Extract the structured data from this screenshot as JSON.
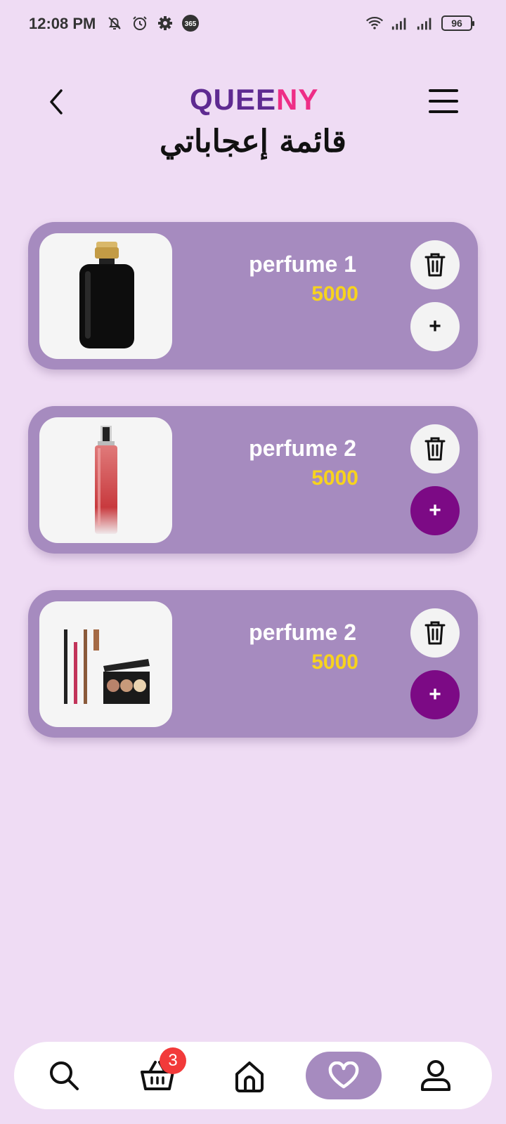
{
  "status_bar": {
    "time": "12:08 PM",
    "left_icons": [
      "mute-bell-icon",
      "alarm-icon",
      "gear-icon",
      "app-365-icon"
    ],
    "app_badge_text": "365",
    "right_icons": [
      "wifi-icon",
      "signal-icon",
      "signal-icon"
    ],
    "battery": "96"
  },
  "header": {
    "logo_part1": "QUEE",
    "logo_part2": "NY",
    "logo_color_1": "#5e2a91",
    "logo_color_2": "#ee2d86",
    "title": "قائمة إعجاباتي"
  },
  "items": [
    {
      "name": "perfume 1",
      "price": "5000",
      "image": "black-perfume-bottle",
      "add_active": false
    },
    {
      "name": "perfume 2",
      "price": "5000",
      "image": "red-perfume-spray",
      "add_active": true
    },
    {
      "name": "perfume 2",
      "price": "5000",
      "image": "makeup-palette-and-pencils",
      "add_active": true
    }
  ],
  "buttons": {
    "add_label": "+"
  },
  "bottom_nav": {
    "items": [
      "search-icon",
      "basket-icon",
      "home-icon",
      "heart-icon",
      "user-icon"
    ],
    "active": "heart-icon",
    "cart_count": "3"
  },
  "colors": {
    "background": "#efdcf4",
    "card": "#a68bbf",
    "price": "#f7d31e",
    "accent": "#7c0a85"
  }
}
